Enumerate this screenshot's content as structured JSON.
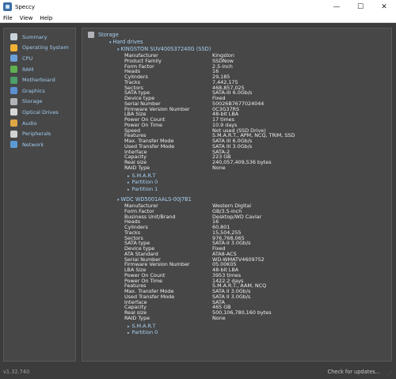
{
  "window": {
    "title": "Speccy",
    "minimize": "—",
    "maximize": "☐",
    "close": "✕"
  },
  "menu": [
    "File",
    "View",
    "Help"
  ],
  "sidebar": [
    {
      "label": "Summary",
      "icon": "summary-icon",
      "color": "#c9d1d9"
    },
    {
      "label": "Operating System",
      "icon": "windows-icon",
      "color": "#f2b134"
    },
    {
      "label": "CPU",
      "icon": "cpu-icon",
      "color": "#6ca0d8"
    },
    {
      "label": "RAM",
      "icon": "ram-icon",
      "color": "#5fb04f"
    },
    {
      "label": "Motherboard",
      "icon": "motherboard-icon",
      "color": "#4c9f6a"
    },
    {
      "label": "Graphics",
      "icon": "graphics-icon",
      "color": "#5a8fd1"
    },
    {
      "label": "Storage",
      "icon": "storage-icon",
      "color": "#b0b4b8"
    },
    {
      "label": "Optical Drives",
      "icon": "optical-drive-icon",
      "color": "#d8d8d8"
    },
    {
      "label": "Audio",
      "icon": "audio-icon",
      "color": "#e0a646"
    },
    {
      "label": "Peripherals",
      "icon": "peripherals-icon",
      "color": "#d2d2d2"
    },
    {
      "label": "Network",
      "icon": "network-icon",
      "color": "#5b9bd5"
    }
  ],
  "content": {
    "section": "Storage",
    "group": "Hard drives",
    "drive1": {
      "name": "KINGSTON SUV400S37240G (SSD)",
      "props": [
        [
          "Manufacturer",
          "Kingston"
        ],
        [
          "Product Family",
          "SSDNow"
        ],
        [
          "Form Factor",
          "2.5-inch"
        ],
        [
          "Heads",
          "16"
        ],
        [
          "Cylinders",
          "29,185"
        ],
        [
          "Tracks",
          "7,442,175"
        ],
        [
          "Sectors",
          "468,857,025"
        ],
        [
          "SATA type",
          "SATA-III 6.0Gb/s"
        ],
        [
          "Device type",
          "Fixed"
        ],
        [
          "Serial Number",
          "50026B7677024044"
        ],
        [
          "Firmware Version Number",
          "0C3G37RS"
        ],
        [
          "LBA Size",
          "48-bit LBA"
        ],
        [
          "Power On Count",
          "17 times"
        ],
        [
          "Power On Time",
          "10.9 days"
        ],
        [
          "Speed",
          "Not used (SSD Drive)"
        ],
        [
          "Features",
          "S.M.A.R.T., APM, NCQ, TRIM, SSD"
        ],
        [
          "Max. Transfer Mode",
          "SATA III 6.0Gb/s"
        ],
        [
          "Used Transfer Mode",
          "SATA III 3.0Gb/s"
        ],
        [
          "Interface",
          "SATA-2"
        ],
        [
          "Capacity",
          "223 GB"
        ],
        [
          "Real size",
          "240,057,409,536 bytes"
        ],
        [
          "RAID Type",
          "None"
        ]
      ],
      "subs": [
        "S.M.A.R.T",
        "Partition 0",
        "Partition 1"
      ]
    },
    "drive2": {
      "name": "WDC WD5001AALS-00J7B1",
      "props": [
        [
          "Manufacturer",
          "Western Digital"
        ],
        [
          "Form Factor",
          "GB/3.5-inch"
        ],
        [
          "Business Unit/Brand",
          "Desktop/WD Caviar"
        ],
        [
          "Heads",
          "16"
        ],
        [
          "Cylinders",
          "60,801"
        ],
        [
          "Tracks",
          "15,504,255"
        ],
        [
          "Sectors",
          "976,768,065"
        ],
        [
          "SATA type",
          "SATA-II 3.0Gb/s"
        ],
        [
          "Device type",
          "Fixed"
        ],
        [
          "ATA Standard",
          "ATA8-ACS"
        ],
        [
          "Serial Number",
          "WD-WMATV4609752"
        ],
        [
          "Firmware Version Number",
          "05.00K05"
        ],
        [
          "LBA Size",
          "48-bit LBA"
        ],
        [
          "Power On Count",
          "3953 times"
        ],
        [
          "Power On Time",
          "1422.2 days"
        ],
        [
          "Features",
          "S.M.A.R.T., AAM, NCQ"
        ],
        [
          "Max. Transfer Mode",
          "SATA II 3.0Gb/s"
        ],
        [
          "Used Transfer Mode",
          "SATA II 3.0Gb/s"
        ],
        [
          "Interface",
          "SATA"
        ],
        [
          "Capacity",
          "465 GB"
        ],
        [
          "Real size",
          "500,106,780,160 bytes"
        ],
        [
          "RAID Type",
          "None"
        ]
      ],
      "subs": [
        "S.M.A.R.T",
        "Partition 0"
      ]
    }
  },
  "status": {
    "version": "v1.32.740",
    "updates": "Check for updates..."
  }
}
